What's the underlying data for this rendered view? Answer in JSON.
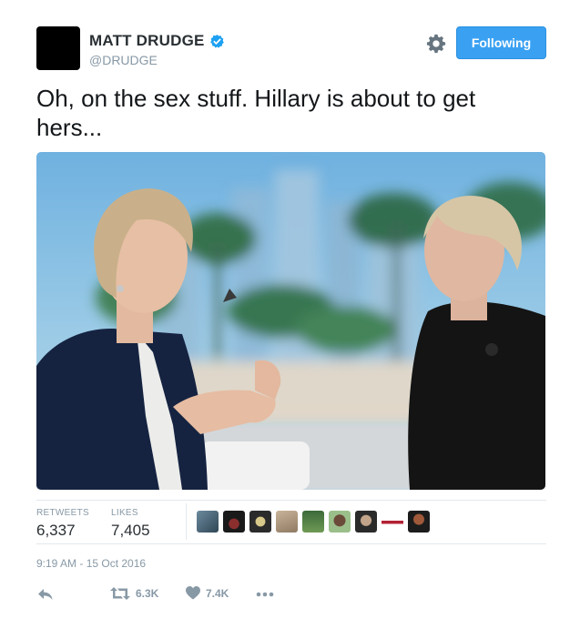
{
  "user": {
    "display_name": "MATT DRUDGE",
    "handle": "@DRUDGE",
    "verified_icon": "verified-badge-icon"
  },
  "follow_button": {
    "label": "Following",
    "color": "#3aa1f2"
  },
  "tweet": {
    "text": "Oh, on the sex stuff. Hillary is about to get hers..."
  },
  "stats": {
    "retweets": {
      "label": "RETWEETS",
      "value": "6,337"
    },
    "likes": {
      "label": "LIKES",
      "value": "7,405"
    }
  },
  "liker_avatar_count": 9,
  "timestamp": "9:19 AM - 15 Oct 2016",
  "actions": {
    "reply_icon": "reply-icon",
    "retweet": {
      "icon": "retweet-icon",
      "count": "6.3K"
    },
    "like": {
      "icon": "heart-icon",
      "count": "7.4K"
    },
    "more_icon": "more-icon"
  },
  "colors": {
    "accent": "#1da1f2",
    "muted": "#8899a6",
    "text": "#292f33"
  }
}
